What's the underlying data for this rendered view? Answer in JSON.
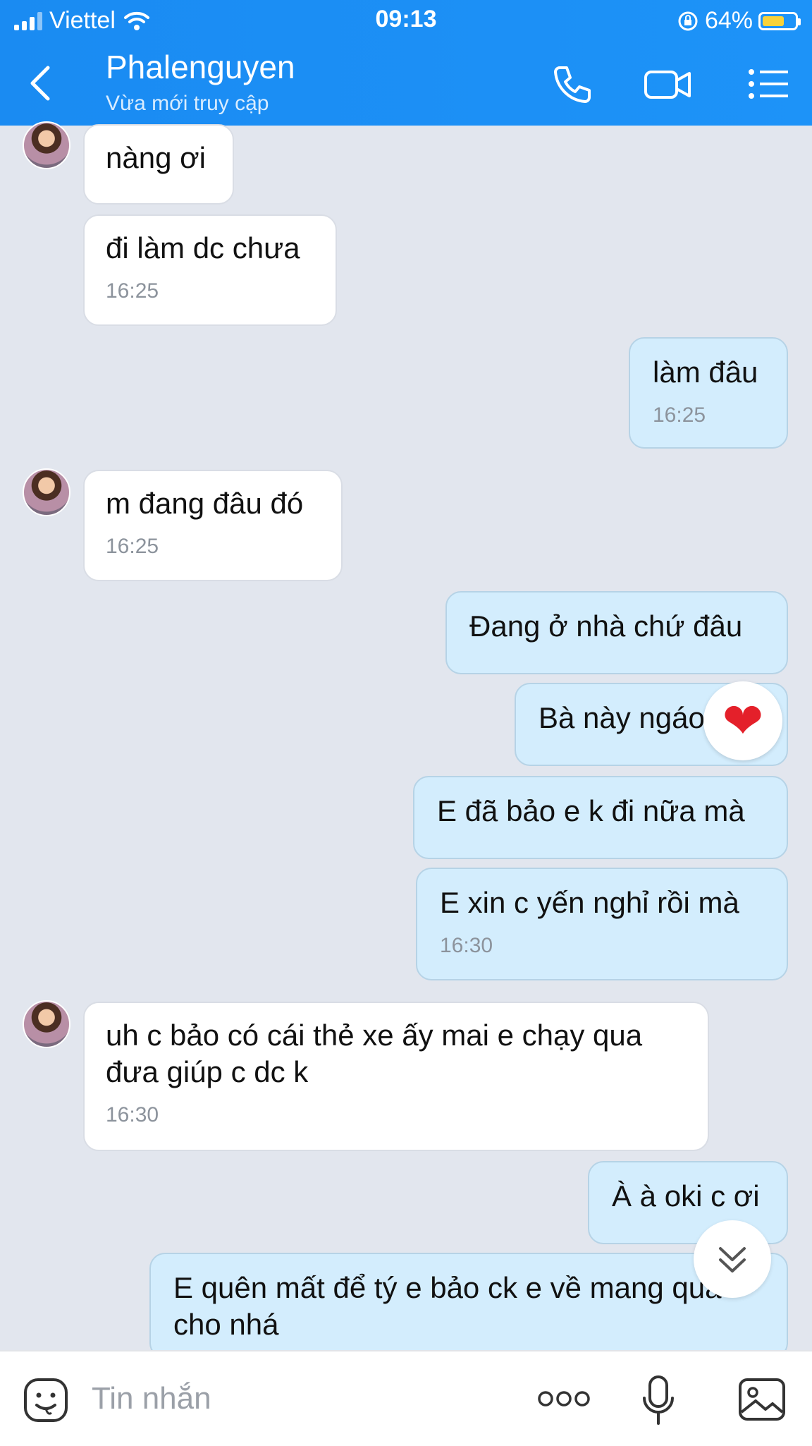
{
  "status_bar": {
    "carrier": "Viettel",
    "time": "09:13",
    "battery": "64%"
  },
  "header": {
    "title": "Phalenguyen",
    "subtitle": "Vừa mới truy cập"
  },
  "icons": {
    "back": "back-arrow-icon",
    "call": "phone-icon",
    "video": "video-camera-icon",
    "menu": "menu-list-icon",
    "emoji": "emoji-sticker-icon",
    "more": "more-dots-icon",
    "mic": "microphone-icon",
    "gallery": "image-gallery-icon",
    "reaction": "heart-icon",
    "scroll": "scroll-down-icon"
  },
  "colors": {
    "header": "#1A8BF2",
    "outgoing_bubble": "#D3EDFD",
    "incoming_bubble": "#FFFFFF",
    "background": "#E2E6EE"
  },
  "messages": [
    {
      "from": "in",
      "text": "nàng ơi"
    },
    {
      "from": "in",
      "text": "đi làm dc chưa",
      "time": "16:25"
    },
    {
      "from": "out",
      "text": "làm đâu",
      "time": "16:25"
    },
    {
      "from": "in",
      "text": "m đang đâu đó",
      "time": "16:25"
    },
    {
      "from": "out",
      "text": "Đang ở nhà chứ đâu"
    },
    {
      "from": "out",
      "text": "Bà này ngáo",
      "reaction": "❤"
    },
    {
      "from": "out",
      "text": "E đã bảo e k đi nữa mà"
    },
    {
      "from": "out",
      "text": "E xin c yến nghỉ rồi mà",
      "time": "16:30"
    },
    {
      "from": "in",
      "text": "uh c bảo có cái thẻ xe ấy mai e chạy qua đưa giúp c dc k",
      "time": "16:30"
    },
    {
      "from": "out",
      "text": "À à oki c ơi"
    },
    {
      "from": "out",
      "text": "E quên mất để tý e bảo ck e về mang qua cho nhá"
    }
  ],
  "composer": {
    "placeholder": "Tin nhắn"
  }
}
